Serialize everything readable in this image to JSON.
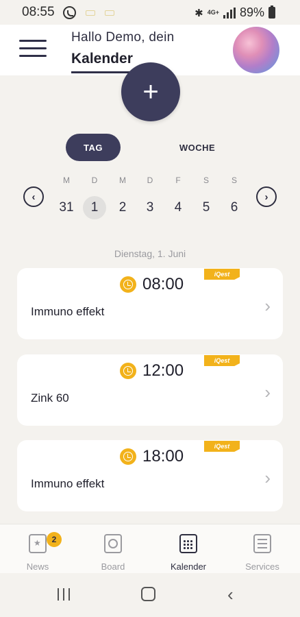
{
  "status_bar": {
    "time": "08:55",
    "battery": "89%",
    "network": "4G+"
  },
  "header": {
    "greeting": "Hallo Demo, dein",
    "title": "Kalender"
  },
  "add_button": {
    "label": "+"
  },
  "view_toggle": {
    "day": "TAG",
    "week": "WOCHE",
    "selected": "TAG"
  },
  "week": {
    "days": [
      {
        "letter": "M",
        "date": "31"
      },
      {
        "letter": "D",
        "date": "1",
        "selected": true
      },
      {
        "letter": "M",
        "date": "2"
      },
      {
        "letter": "D",
        "date": "3"
      },
      {
        "letter": "F",
        "date": "4"
      },
      {
        "letter": "S",
        "date": "5"
      },
      {
        "letter": "S",
        "date": "6"
      }
    ],
    "prev_label": "‹",
    "next_label": "›"
  },
  "selected_date_label": "Dienstag, 1. Juni",
  "events": [
    {
      "time": "08:00",
      "name": "Immuno effekt",
      "brand": "iQest"
    },
    {
      "time": "12:00",
      "name": "Zink 60",
      "brand": "iQest"
    },
    {
      "time": "18:00",
      "name": "Immuno effekt",
      "brand": "iQest"
    }
  ],
  "bottom_nav": {
    "items": [
      {
        "label": "News",
        "badge": "2"
      },
      {
        "label": "Board"
      },
      {
        "label": "Kalender",
        "active": true
      },
      {
        "label": "Services"
      }
    ]
  },
  "colors": {
    "primary": "#3d3d5c",
    "accent": "#f2b21b",
    "background": "#f4f2ee"
  }
}
